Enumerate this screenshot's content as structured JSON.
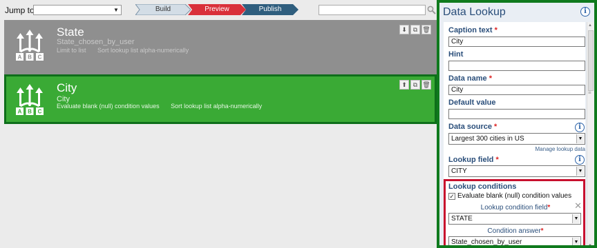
{
  "toolbar": {
    "jump_label": "Jump to",
    "jump_value": "",
    "steps": [
      "Build",
      "Preview",
      "Publish"
    ],
    "search_placeholder": ""
  },
  "questions": [
    {
      "caption": "State",
      "data_name": "State_chosen_by_user",
      "properties": [
        "Limit to list",
        "Sort lookup list alpha-numerically"
      ]
    },
    {
      "caption": "City",
      "data_name": "City",
      "properties": [
        "Evaluate blank (null) condition values",
        "Sort lookup list alpha-numerically"
      ]
    }
  ],
  "panel": {
    "title": "Data Lookup",
    "caption_label": "Caption text",
    "caption_value": "City",
    "hint_label": "Hint",
    "hint_value": "",
    "data_name_label": "Data name",
    "data_name_value": "City",
    "default_label": "Default value",
    "default_value": "",
    "data_source_label": "Data source",
    "data_source_value": "Largest 300 cities in US",
    "manage_link": "Manage lookup data",
    "lookup_field_label": "Lookup field",
    "lookup_field_value": "CITY",
    "conditions": {
      "title": "Lookup conditions",
      "evaluate_blank_label": "Evaluate blank (null) condition values",
      "evaluate_blank_checked": true,
      "condition_field_label": "Lookup condition field",
      "condition_field_value": "STATE",
      "condition_answer_label": "Condition answer",
      "condition_answer_value": "State_chosen_by_user"
    },
    "required_mark": "*"
  },
  "colors": {
    "selected_card": "#3aaa35",
    "selected_border": "#0e6e1a",
    "other_card": "#8f8f8f",
    "preview_step": "#d9303a",
    "publish_step": "#2f5e7e",
    "conditions_border": "#c8102e"
  }
}
